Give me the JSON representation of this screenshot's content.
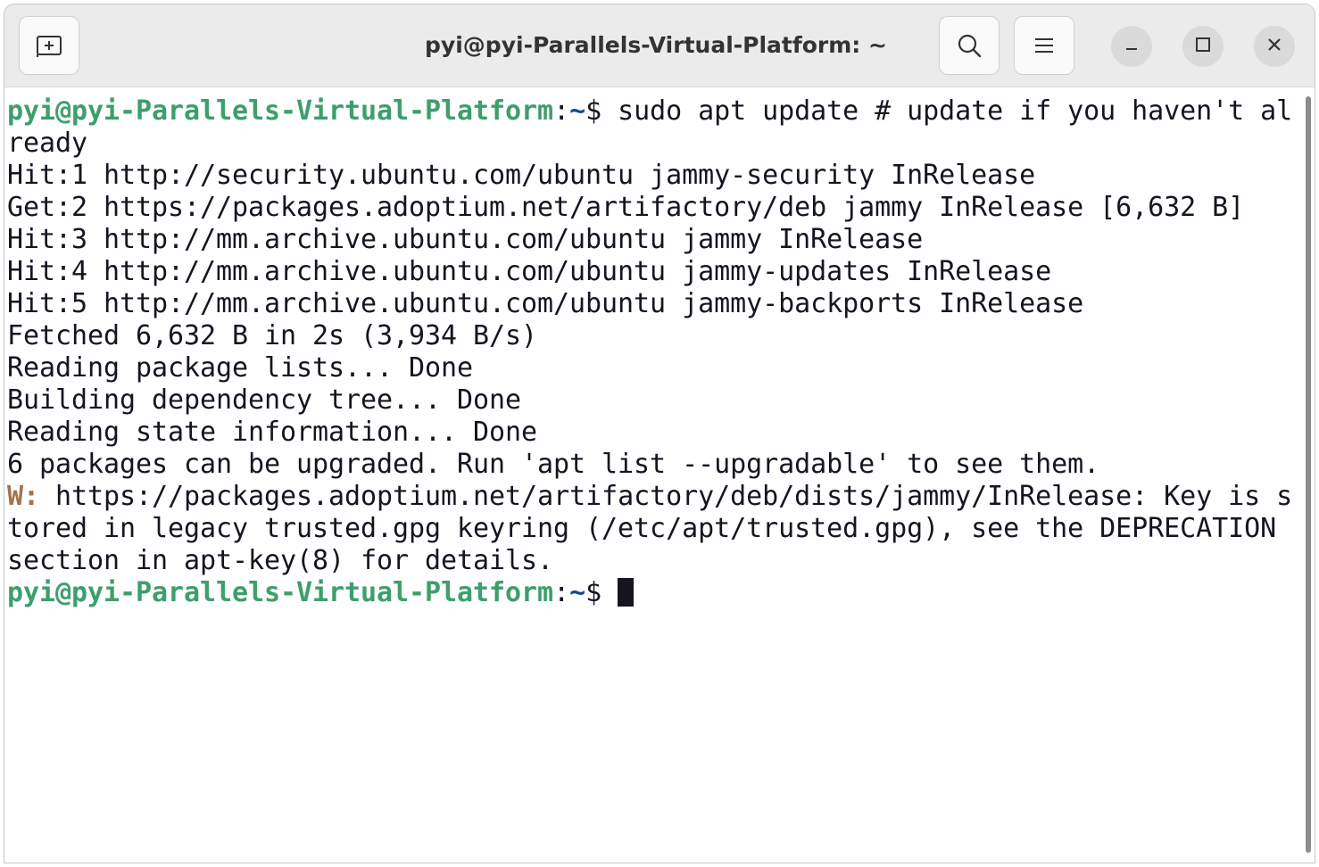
{
  "window": {
    "title": "pyi@pyi-Parallels-Virtual-Platform: ~"
  },
  "icons": {
    "new_tab": "new-tab-icon",
    "search": "search-icon",
    "menu": "hamburger-menu-icon",
    "minimize": "minimize-icon",
    "maximize": "maximize-icon",
    "close": "close-icon"
  },
  "colors": {
    "prompt_user": "#3d9f6b",
    "prompt_path": "#12488b",
    "warning": "#a2734c",
    "text": "#171421",
    "background": "#ffffff"
  },
  "terminal": {
    "prompt_user_host": "pyi@pyi-Parallels-Virtual-Platform",
    "prompt_sep": ":",
    "prompt_path": "~",
    "prompt_symbol": "$ ",
    "command_part1": "sudo apt update # update if you haven't al",
    "command_part2": "ready",
    "output": [
      "Hit:1 http://security.ubuntu.com/ubuntu jammy-security InRelease",
      "Get:2 https://packages.adoptium.net/artifactory/deb jammy InRelease [6,632 B]",
      "Hit:3 http://mm.archive.ubuntu.com/ubuntu jammy InRelease",
      "Hit:4 http://mm.archive.ubuntu.com/ubuntu jammy-updates InRelease",
      "Hit:5 http://mm.archive.ubuntu.com/ubuntu jammy-backports InRelease",
      "Fetched 6,632 B in 2s (3,934 B/s)",
      "Reading package lists... Done",
      "Building dependency tree... Done",
      "Reading state information... Done",
      "6 packages can be upgraded. Run 'apt list --upgradable' to see them."
    ],
    "warning_prefix": "W:",
    "warning_lines": [
      " https://packages.adoptium.net/artifactory/deb/dists/jammy/InRelease: Key is s",
      "tored in legacy trusted.gpg keyring (/etc/apt/trusted.gpg), see the DEPRECATION",
      "section in apt-key(8) for details."
    ]
  }
}
